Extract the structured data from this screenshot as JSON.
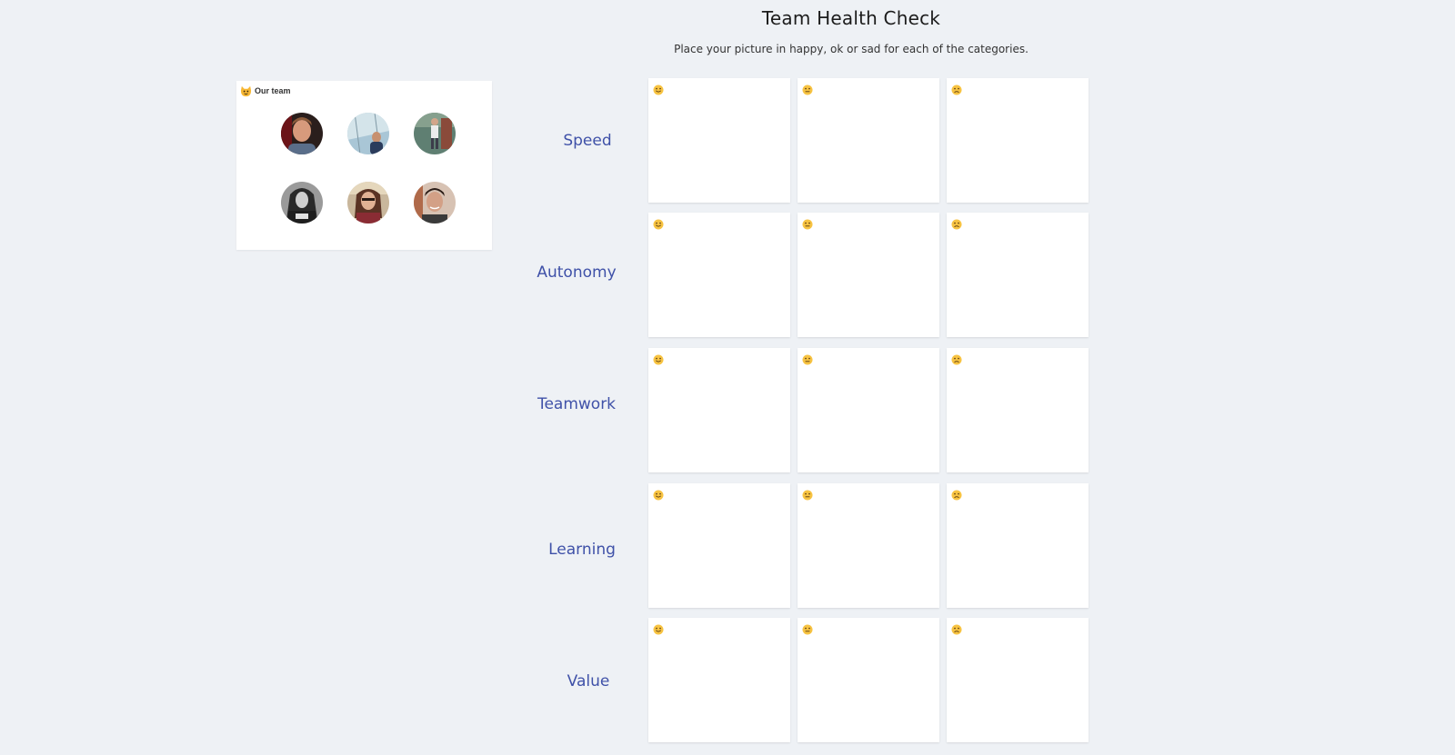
{
  "header": {
    "title": "Team Health Check",
    "subtitle": "Place your picture in happy, ok or sad for each of the categories."
  },
  "team": {
    "title": "Our team",
    "icon": "cat-emoji-icon",
    "members": [
      {
        "name": "member-1",
        "tone": "#b5735a"
      },
      {
        "name": "member-2",
        "tone": "#8fb0c8"
      },
      {
        "name": "member-3",
        "tone": "#6f8e7a"
      },
      {
        "name": "member-4",
        "tone": "#5c5c5c"
      },
      {
        "name": "member-5",
        "tone": "#a97a5a"
      },
      {
        "name": "member-6",
        "tone": "#c99a80"
      }
    ]
  },
  "columns": [
    {
      "key": "happy",
      "icon": "happy-face-icon"
    },
    {
      "key": "ok",
      "icon": "neutral-face-icon"
    },
    {
      "key": "sad",
      "icon": "sad-face-icon"
    }
  ],
  "categories": [
    {
      "label": "Speed"
    },
    {
      "label": "Autonomy"
    },
    {
      "label": "Teamwork"
    },
    {
      "label": "Learning"
    },
    {
      "label": "Value"
    }
  ],
  "colors": {
    "background": "#eef1f5",
    "label": "#3f51a8",
    "emoji": "#f7c342"
  }
}
